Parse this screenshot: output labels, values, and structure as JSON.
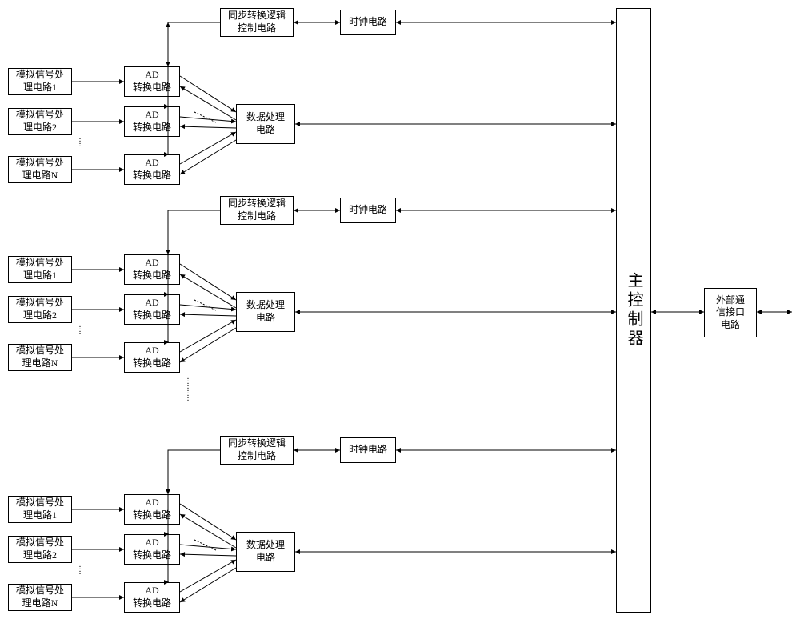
{
  "labels": {
    "analog_prefix": "模拟信号处",
    "analog_suffix_1": "理电路1",
    "analog_suffix_2": "理电路2",
    "analog_suffix_N": "理电路N",
    "ad_line1": "AD",
    "ad_line2": "转换电路",
    "sync_line1": "同步转换逻辑",
    "sync_line2": "控制电路",
    "clock": "时钟电路",
    "data_line1": "数据处理",
    "data_line2": "电路",
    "main_ctrl": "主控制器",
    "ext_line1": "外部通",
    "ext_line2": "信接口",
    "ext_line3": "电路"
  }
}
